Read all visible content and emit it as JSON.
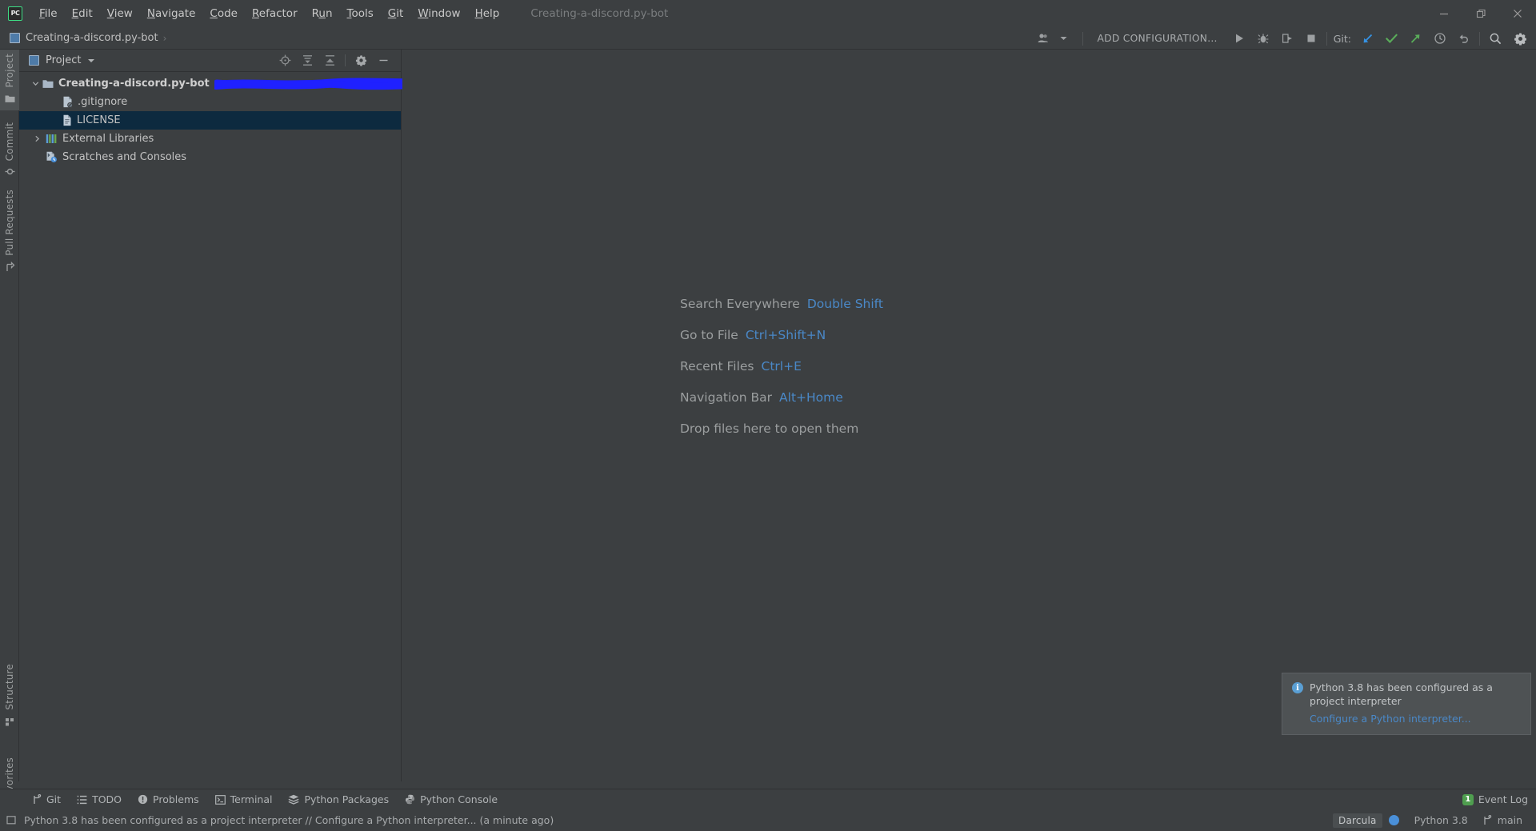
{
  "window": {
    "title": "Creating-a-discord.py-bot",
    "controls": {
      "minimize": "minimize-window",
      "maximize": "restore-window",
      "close": "close-window"
    }
  },
  "menu": {
    "items": [
      {
        "label": "File",
        "mnemonic": "F"
      },
      {
        "label": "Edit",
        "mnemonic": "E"
      },
      {
        "label": "View",
        "mnemonic": "V"
      },
      {
        "label": "Navigate",
        "mnemonic": "N"
      },
      {
        "label": "Code",
        "mnemonic": "C"
      },
      {
        "label": "Refactor",
        "mnemonic": "R"
      },
      {
        "label": "Run",
        "mnemonic": "u"
      },
      {
        "label": "Tools",
        "mnemonic": "T"
      },
      {
        "label": "Git",
        "mnemonic": "G"
      },
      {
        "label": "Window",
        "mnemonic": "W"
      },
      {
        "label": "Help",
        "mnemonic": "H"
      }
    ]
  },
  "navbar": {
    "breadcrumb": "Creating-a-discord.py-bot",
    "separator": "›",
    "add_configuration": "ADD CONFIGURATION...",
    "git_label": "Git:",
    "buttons": [
      {
        "name": "run-button",
        "label": "Run"
      },
      {
        "name": "debug-button",
        "label": "Debug"
      },
      {
        "name": "run-with-coverage-button",
        "label": "Run with Coverage"
      },
      {
        "name": "stop-button",
        "label": "Stop"
      },
      {
        "name": "git-update-project-button",
        "label": "Update Project"
      },
      {
        "name": "git-commit-button",
        "label": "Commit"
      },
      {
        "name": "git-push-button",
        "label": "Push"
      },
      {
        "name": "git-history-button",
        "label": "History"
      },
      {
        "name": "git-rollback-button",
        "label": "Rollback"
      },
      {
        "name": "search-everywhere-button",
        "label": "Search Everywhere"
      },
      {
        "name": "settings-button",
        "label": "Settings"
      }
    ]
  },
  "stripe": {
    "left_top": [
      {
        "label": "Project",
        "icon": "folder-icon",
        "active": true
      },
      {
        "label": "Commit",
        "icon": "commit-icon",
        "active": false
      },
      {
        "label": "Pull Requests",
        "icon": "pull-request-icon",
        "active": false
      }
    ],
    "left_bottom": [
      {
        "label": "Structure",
        "icon": "structure-icon",
        "active": false
      },
      {
        "label": "Favorites",
        "icon": "star-icon",
        "active": false
      }
    ]
  },
  "project_panel": {
    "title": "Project",
    "tools": [
      {
        "name": "select-opened-file-button",
        "label": "Select Opened File"
      },
      {
        "name": "expand-all-button",
        "label": "Expand All"
      },
      {
        "name": "collapse-all-button",
        "label": "Collapse All"
      },
      {
        "name": "panel-options-button",
        "label": "Options"
      },
      {
        "name": "hide-panel-button",
        "label": "Hide"
      }
    ],
    "tree": [
      {
        "label": "Creating-a-discord.py-bot",
        "icon": "folder-icon",
        "depth": 0,
        "expanded": true,
        "bold": true,
        "selected": false,
        "redacted": true
      },
      {
        "label": ".gitignore",
        "icon": "gitignore-file-icon",
        "depth": 1,
        "expanded": null,
        "bold": false,
        "selected": false,
        "redacted": false
      },
      {
        "label": "LICENSE",
        "icon": "license-file-icon",
        "depth": 1,
        "expanded": null,
        "bold": false,
        "selected": true,
        "redacted": false
      },
      {
        "label": "External Libraries",
        "icon": "library-icon",
        "depth": 0,
        "expanded": false,
        "bold": false,
        "selected": false,
        "redacted": false
      },
      {
        "label": "Scratches and Consoles",
        "icon": "scratches-icon",
        "depth": 0,
        "expanded": null,
        "bold": false,
        "selected": false,
        "redacted": false
      }
    ]
  },
  "editor": {
    "hints": [
      {
        "action": "Search Everywhere",
        "shortcut": "Double Shift"
      },
      {
        "action": "Go to File",
        "shortcut": "Ctrl+Shift+N"
      },
      {
        "action": "Recent Files",
        "shortcut": "Ctrl+E"
      },
      {
        "action": "Navigation Bar",
        "shortcut": "Alt+Home"
      },
      {
        "action": "Drop files here to open them",
        "shortcut": ""
      }
    ]
  },
  "notification": {
    "icon": "info-icon",
    "message": "Python 3.8 has been configured as a project interpreter",
    "link": "Configure a Python interpreter..."
  },
  "tool_window_bar": {
    "items": [
      {
        "label": "Git",
        "icon": "git-branch-icon"
      },
      {
        "label": "TODO",
        "icon": "list-icon"
      },
      {
        "label": "Problems",
        "icon": "problems-icon"
      },
      {
        "label": "Terminal",
        "icon": "terminal-icon"
      },
      {
        "label": "Python Packages",
        "icon": "packages-icon"
      },
      {
        "label": "Python Console",
        "icon": "python-icon"
      }
    ],
    "event_log": {
      "label": "Event Log",
      "count": "1"
    }
  },
  "status_bar": {
    "icon": "memory-indicator-icon",
    "message": "Python 3.8 has been configured as a project interpreter // Configure a Python interpreter... (a minute ago)",
    "theme": "Darcula",
    "interpreter": "Python 3.8",
    "branch": "main"
  },
  "colors": {
    "background": "#3c3f41",
    "selection": "#0d2a3f",
    "accent_link": "#4a88c7",
    "redaction": "#1f21ff",
    "green": "#4f9e4f",
    "menu_text": "#c8c8c8"
  }
}
